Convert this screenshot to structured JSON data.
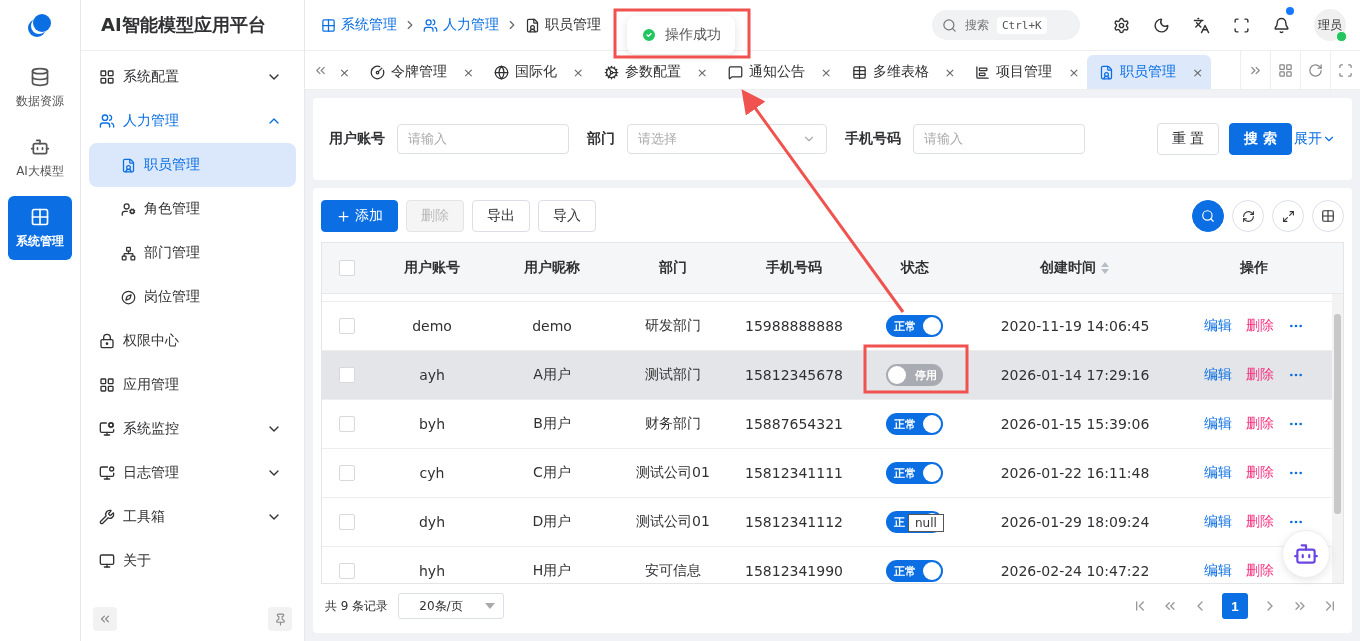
{
  "rail": [
    {
      "label": "数据资源",
      "selected": false
    },
    {
      "label": "AI大模型",
      "selected": false
    },
    {
      "label": "系统管理",
      "selected": true
    }
  ],
  "app_title": "AI智能模型应用平台",
  "menu": [
    {
      "label": "系统配置",
      "kind": "group",
      "expanded": false
    },
    {
      "label": "人力管理",
      "kind": "group",
      "expanded": true,
      "children": [
        {
          "label": "职员管理",
          "selected": true
        },
        {
          "label": "角色管理",
          "selected": false
        },
        {
          "label": "部门管理",
          "selected": false
        },
        {
          "label": "岗位管理",
          "selected": false
        }
      ]
    },
    {
      "label": "权限中心",
      "kind": "item"
    },
    {
      "label": "应用管理",
      "kind": "item"
    },
    {
      "label": "系统监控",
      "kind": "group",
      "expanded": false
    },
    {
      "label": "日志管理",
      "kind": "group",
      "expanded": false
    },
    {
      "label": "工具箱",
      "kind": "group",
      "expanded": false
    },
    {
      "label": "关于",
      "kind": "item"
    }
  ],
  "breadcrumb": [
    {
      "label": "系统管理",
      "current": false
    },
    {
      "label": "人力管理",
      "current": false
    },
    {
      "label": "职员管理",
      "current": true
    }
  ],
  "search": {
    "placeholder": "搜索",
    "shortcut": "Ctrl+K"
  },
  "notifications": {
    "unread": true
  },
  "avatar": {
    "text": "理员",
    "online": true
  },
  "tabs_cut_close": "×",
  "tabs": [
    {
      "label": "令牌管理",
      "close": "×",
      "selected": false
    },
    {
      "label": "国际化",
      "close": "×",
      "selected": false
    },
    {
      "label": "参数配置",
      "close": "×",
      "selected": false
    },
    {
      "label": "通知公告",
      "close": "×",
      "selected": false
    },
    {
      "label": "多维表格",
      "close": "×",
      "selected": false
    },
    {
      "label": "项目管理",
      "close": "×",
      "selected": false
    },
    {
      "label": "职员管理",
      "close": "×",
      "selected": true
    }
  ],
  "filters": [
    {
      "label": "用户账号",
      "placeholder": "请输入",
      "kind": "input"
    },
    {
      "label": "部门",
      "placeholder": "请选择",
      "kind": "select"
    },
    {
      "label": "手机号码",
      "placeholder": "请输入",
      "kind": "input"
    }
  ],
  "filter_buttons": {
    "reset": "重 置",
    "search": "搜 索",
    "expand": "展开"
  },
  "toolbar": [
    {
      "label": "添加",
      "kind": "primary",
      "disabled": false
    },
    {
      "label": "删除",
      "kind": "default",
      "disabled": true
    },
    {
      "label": "导出",
      "kind": "default",
      "disabled": false
    },
    {
      "label": "导入",
      "kind": "default",
      "disabled": false
    }
  ],
  "table": {
    "select_all_checked": false,
    "columns": [
      {
        "label": "用户账号",
        "sortable": false
      },
      {
        "label": "用户昵称",
        "sortable": false
      },
      {
        "label": "部门",
        "sortable": false
      },
      {
        "label": "手机号码",
        "sortable": false
      },
      {
        "label": "状态",
        "sortable": false
      },
      {
        "label": "创建时间",
        "sortable": true
      },
      {
        "label": "操作",
        "sortable": false
      }
    ],
    "rows": [
      {
        "account": "demo",
        "nickname": "demo",
        "dept": "研发部门",
        "phone": "15988888888",
        "on": true,
        "status": "正常",
        "created": "2020-11-19 14:06:45",
        "edit": "编辑",
        "delete": "删除",
        "highlighted": false,
        "checked": false
      },
      {
        "account": "ayh",
        "nickname": "A用户",
        "dept": "测试部门",
        "phone": "15812345678",
        "on": false,
        "status": "停用",
        "created": "2026-01-14 17:29:16",
        "edit": "编辑",
        "delete": "删除",
        "highlighted": true,
        "checked": false
      },
      {
        "account": "byh",
        "nickname": "B用户",
        "dept": "财务部门",
        "phone": "15887654321",
        "on": true,
        "status": "正常",
        "created": "2026-01-15 15:39:06",
        "edit": "编辑",
        "delete": "删除",
        "highlighted": false,
        "checked": false
      },
      {
        "account": "cyh",
        "nickname": "C用户",
        "dept": "测试公司01",
        "phone": "15812341111",
        "on": true,
        "status": "正常",
        "created": "2026-01-22 16:11:48",
        "edit": "编辑",
        "delete": "删除",
        "highlighted": false,
        "checked": false
      },
      {
        "account": "dyh",
        "nickname": "D用户",
        "dept": "测试公司01",
        "phone": "15812341112",
        "on": true,
        "status": "正",
        "created": "2026-01-29 18:09:24",
        "edit": "编辑",
        "delete": "删除",
        "highlighted": false,
        "checked": false,
        "tooltip": "null"
      },
      {
        "account": "hyh",
        "nickname": "H用户",
        "dept": "安可信息",
        "phone": "15812341990",
        "on": true,
        "status": "正常",
        "created": "2026-02-24 10:47:22",
        "edit": "编辑",
        "delete": "删除",
        "highlighted": false,
        "checked": false,
        "more_visible": false
      }
    ]
  },
  "footer": {
    "total": "共 9 条记录",
    "page_size": "20条/页",
    "pages": [
      {
        "label": "1",
        "selected": true
      }
    ]
  },
  "toast": {
    "text": "操作成功"
  }
}
